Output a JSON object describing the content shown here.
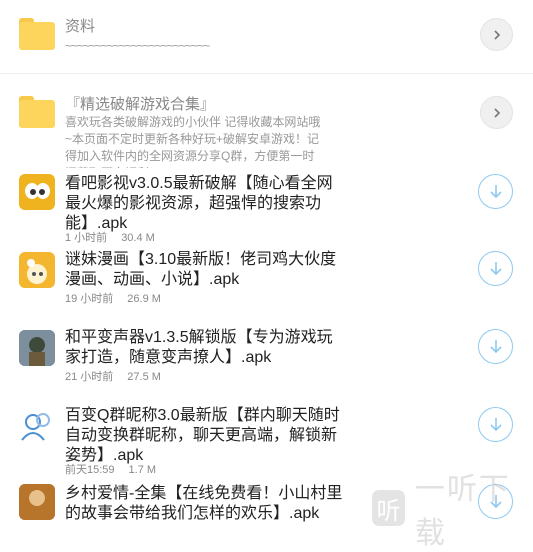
{
  "folders": [
    {
      "title": "资料",
      "desc": "~~~~~~~~~~~~~~~~~~~~~~~~"
    },
    {
      "title": "『精选破解游戏合集』",
      "desc": "喜欢玩各类破解游戏的小伙伴 记得收藏本网站哦~本页面不定时更新各种好玩+破解安卓游戏！记得加入软件内的全网资源分享Q群，方便第一时间获取更多福利！"
    }
  ],
  "files": [
    {
      "title": "看吧影视v3.0.5最新破解【随心看全网最火爆的影视资源，超强悍的搜索功能】.apk",
      "time": "1 小时前",
      "size": "30.4 M"
    },
    {
      "title": "谜妹漫画【3.10最新版！佬司鸡大伙度漫画、动画、小说】.apk",
      "time": "19 小时前",
      "size": "26.9 M"
    },
    {
      "title": "和平变声器v1.3.5解锁版【专为游戏玩家打造，随意变声撩人】.apk",
      "time": "21 小时前",
      "size": "27.5 M"
    },
    {
      "title": "百变Q群昵称3.0最新版【群内聊天随时自动变换群昵称，聊天更高端，解锁新姿势】.apk",
      "time": "前天15:59",
      "size": "1.7 M"
    },
    {
      "title": "乡村爱情-全集【在线免费看！小山村里的故事会带给我们怎样的欢乐】.apk",
      "time": "",
      "size": ""
    }
  ],
  "watermark": {
    "glyph": "听",
    "text": "一听下载"
  },
  "colors": {
    "folder": "#fdd45c",
    "download_ring": "#8ec9ef"
  }
}
